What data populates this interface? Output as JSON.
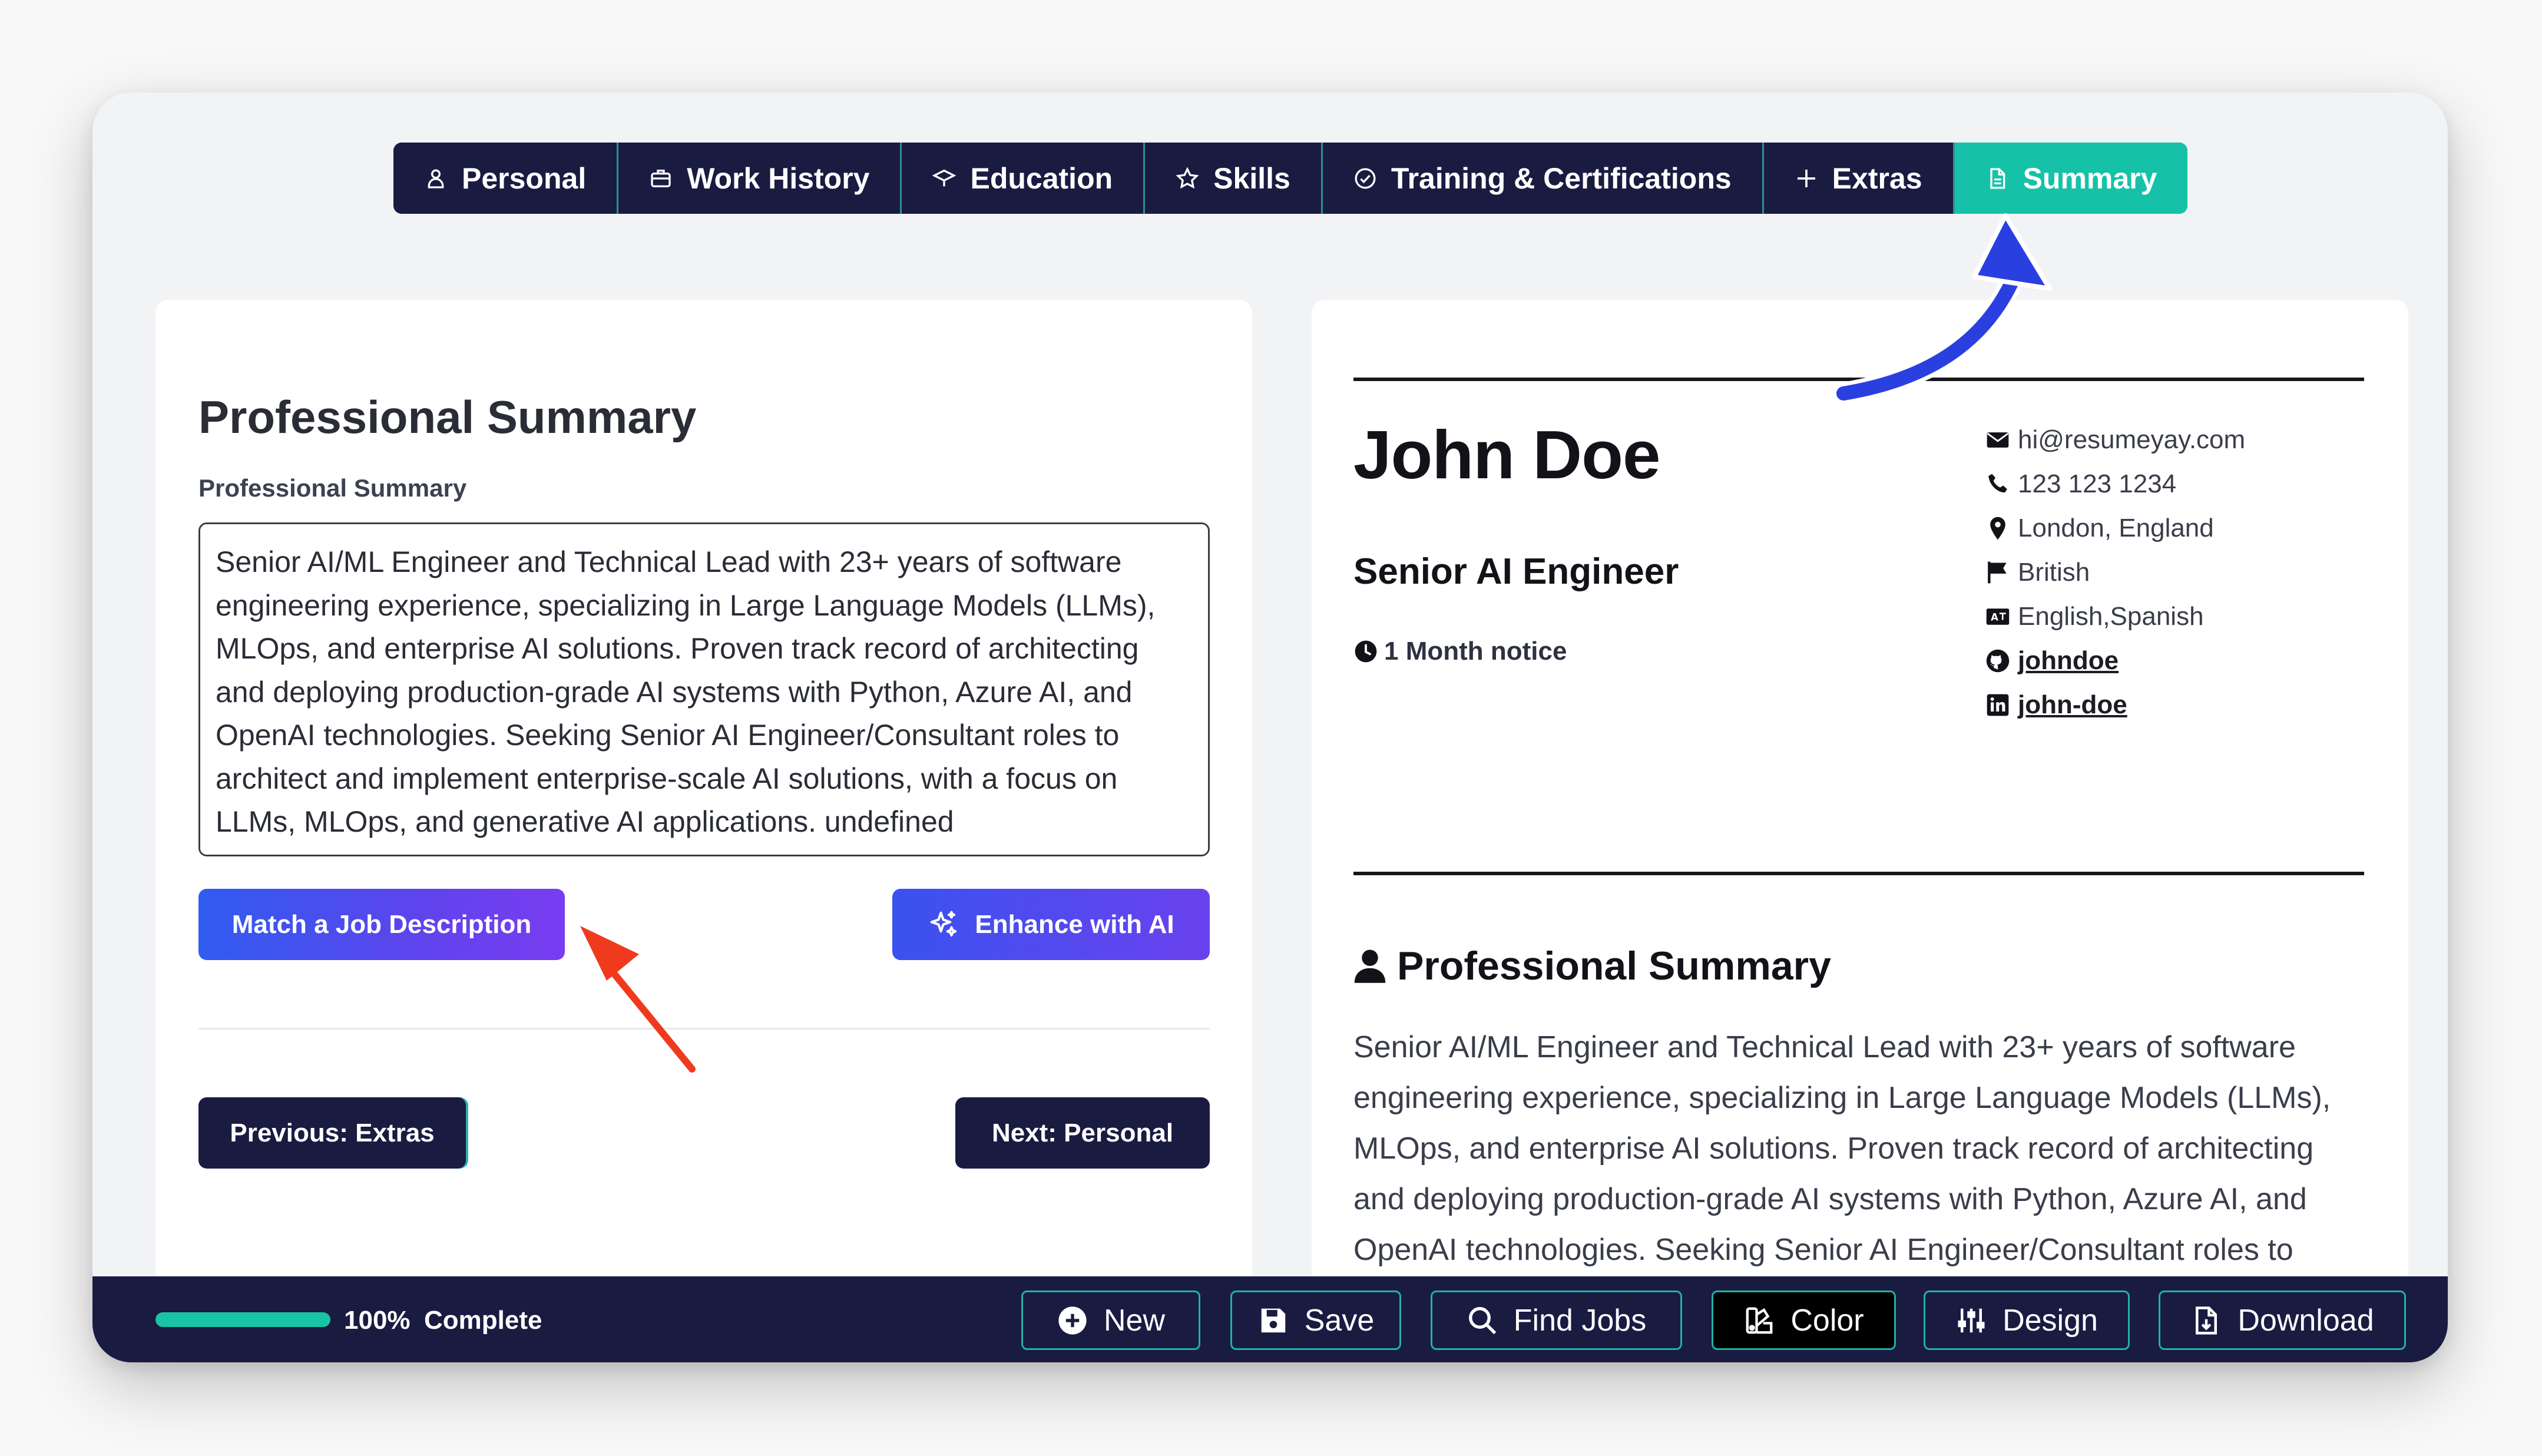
{
  "tabs": [
    {
      "label": "Personal",
      "icon": "user-icon"
    },
    {
      "label": "Work History",
      "icon": "briefcase-icon"
    },
    {
      "label": "Education",
      "icon": "graduation-cap-icon"
    },
    {
      "label": "Skills",
      "icon": "star-icon"
    },
    {
      "label": "Training & Certifications",
      "icon": "check-circle-icon"
    },
    {
      "label": "Extras",
      "icon": "plus-icon"
    },
    {
      "label": "Summary",
      "icon": "document-icon",
      "active": true
    }
  ],
  "editor": {
    "title": "Professional Summary",
    "field_label": "Professional Summary",
    "summary_text": "Senior AI/ML Engineer and Technical Lead with 23+ years of software engineering experience, specializing in Large Language Models (LLMs), MLOps, and enterprise AI solutions. Proven track record of architecting and deploying production-grade AI systems with Python, Azure AI, and OpenAI technologies. Seeking Senior AI Engineer/Consultant roles to architect and implement enterprise-scale AI solutions, with a focus on LLMs, MLOps, and generative AI applications. undefined",
    "match_button": "Match a Job Description",
    "enhance_button": "Enhance with AI",
    "prev_button": "Previous: Extras",
    "next_button": "Next: Personal"
  },
  "resume": {
    "name": "John Doe",
    "role": "Senior AI Engineer",
    "notice": "1 Month notice",
    "contacts": {
      "email": "hi@resumeyay.com",
      "phone": "123 123 1234",
      "location": "London, England",
      "nationality": "British",
      "languages": "English,Spanish",
      "github": "johndoe",
      "linkedin": "john-doe"
    },
    "section_title": "Professional Summary",
    "summary_text": "Senior AI/ML Engineer and Technical Lead with 23+ years of software engineering experience, specializing in Large Language Models (LLMs), MLOps, and enterprise AI solutions. Proven track record of architecting and deploying production-grade AI systems with Python, Azure AI, and OpenAI technologies. Seeking Senior AI Engineer/Consultant roles to architect and implement enterprise-scale AI solutions, with a focus on LLMs, MLOps, and generative AI applications. undefined"
  },
  "bottom_bar": {
    "progress_fraction": 1.0,
    "progress_percent": "100%",
    "progress_label": "Complete",
    "buttons": {
      "new": "New",
      "save": "Save",
      "find_jobs": "Find Jobs",
      "color": "Color",
      "design": "Design",
      "download": "Download"
    }
  },
  "colors": {
    "navy": "#1a1b41",
    "teal": "#15c2a8",
    "accent_blue": "#2f5cf0",
    "accent_purple": "#7a3cf0",
    "annotation_red": "#f03a1e",
    "annotation_blue": "#2a3fe0"
  }
}
